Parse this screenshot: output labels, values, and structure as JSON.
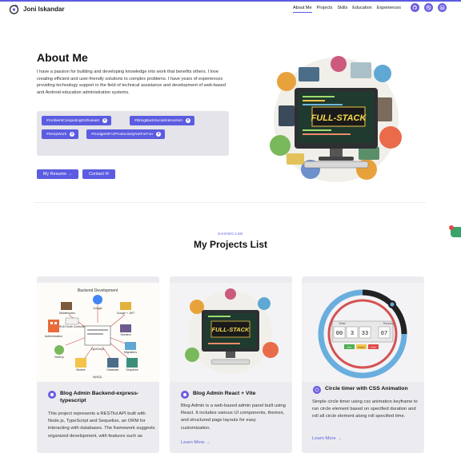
{
  "nav": {
    "brand": "Joni Iskandar",
    "links": [
      "About Me",
      "Projects",
      "Skills",
      "Education",
      "Experiences"
    ],
    "icons": [
      "github-icon",
      "dribbble-icon",
      "linkedin-icon"
    ]
  },
  "about": {
    "title": "About Me",
    "text": "I have a passion for building and developing knowledge into work that benefits others. I love creating efficient and user-friendly solutions to complex problems. I have years of experiences providing technology support in the field of technical assistance and development of web-based and Android education administration systems.",
    "tags": [
      "#AmbientComputingEnthusiast",
      "#BringBackSocialInteraction",
      "#DeepWork",
      "#GadgetIsForProductivityNotForFun"
    ],
    "resume_label": "My Resume →",
    "contact_label": "Contact ✉"
  },
  "hero_image": {
    "screen_text": "FULL-STACK"
  },
  "showcase": {
    "eyebrow": "SHOWCASE",
    "title": "My Projects List"
  },
  "projects": [
    {
      "title": "Blog Admin Backend-express-typescript",
      "description": "This project represents a RESTful API built with Node.js, TypeScript and Sequelize, an ORM for interacting with databases. The framework suggests organized development, with features such as",
      "learn_more": "",
      "image_labels": {
        "title": "Backend Development",
        "nodes": [
          "Google",
          "Middlewares",
          "Google + JWT",
          "CRUD+Auth Controllers",
          "Authentication",
          "TypeScript",
          "Seeders",
          "Node.js",
          "Migrations",
          "Models",
          "Database",
          "Sequelize",
          "MySQL"
        ]
      }
    },
    {
      "title": "Blog Admin React + Vite",
      "description": "Blog Admin is a web-based admin panel built using React. It includes various UI components, themes, and structured page layouts for easy customization.",
      "learn_more": "Learn More →",
      "image_labels": {
        "screen_text": "FULL-STACK"
      }
    },
    {
      "title": "Circle timer with CSS Animation",
      "description": "Simple circle timer using css animation keyframe to run circle element based on specified duration and roll all circle element along roll specified time.",
      "learn_more": "Learn More →",
      "image_labels": {
        "hours": "00",
        "minutes": "3",
        "seconds": "33",
        "rounds": "07",
        "head_left": "Timer",
        "head_right": "Rounds",
        "btn_start": "start",
        "btn_pause": "pause",
        "btn_reset": "reset"
      }
    }
  ]
}
